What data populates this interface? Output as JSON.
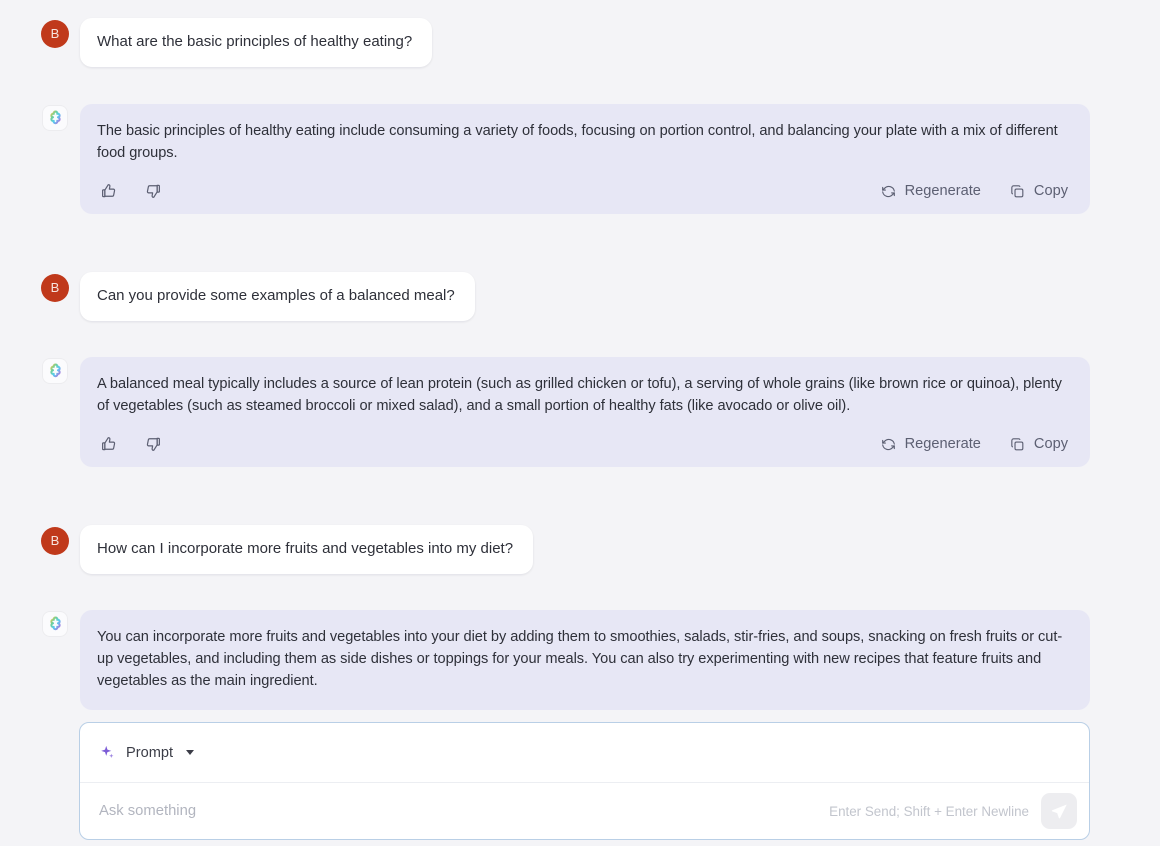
{
  "theme": {
    "page_background": "#f4f4f7",
    "user_bubble": "#ffffff",
    "assistant_bubble": "#e7e7f5",
    "user_avatar_color": "#c0391b",
    "composer_border": "#b9cfe6",
    "prompt_accent": "#7c5cd6",
    "text_color": "#2e3039",
    "muted_text": "#5c5f72"
  },
  "conversation": [
    {
      "role": "user",
      "avatar_initial": "B",
      "text": "What are the basic principles of healthy eating?"
    },
    {
      "role": "assistant",
      "avatar_icon": "sparkle-flower-icon",
      "text": "The basic principles of healthy eating include consuming a variety of foods, focusing on portion control, and balancing your plate with a mix of different food groups.",
      "actions": {
        "thumbs_up_icon": "thumbs-up-icon",
        "thumbs_down_icon": "thumbs-down-icon",
        "regenerate_label": "Regenerate",
        "copy_label": "Copy"
      }
    },
    {
      "role": "user",
      "avatar_initial": "B",
      "text": "Can you provide some examples of a balanced meal?"
    },
    {
      "role": "assistant",
      "avatar_icon": "sparkle-flower-icon",
      "text": "A balanced meal typically includes a source of lean protein (such as grilled chicken or tofu), a serving of whole grains (like brown rice or quinoa), plenty of vegetables (such as steamed broccoli or mixed salad), and a small portion of healthy fats (like avocado or olive oil).",
      "actions": {
        "thumbs_up_icon": "thumbs-up-icon",
        "thumbs_down_icon": "thumbs-down-icon",
        "regenerate_label": "Regenerate",
        "copy_label": "Copy"
      }
    },
    {
      "role": "user",
      "avatar_initial": "B",
      "text": "How can I incorporate more fruits and vegetables into my diet?"
    },
    {
      "role": "assistant",
      "avatar_icon": "sparkle-flower-icon",
      "text": "You can incorporate more fruits and vegetables into your diet by adding them to smoothies, salads, stir-fries, and soups, snacking on fresh fruits or cut-up vegetables, and including them as side dishes or toppings for your meals. You can also try experimenting with new recipes that feature fruits and vegetables as the main ingredient.",
      "actions": null
    }
  ],
  "composer": {
    "prompt_button_label": "Prompt",
    "prompt_icon": "sparkle-icon",
    "dropdown_icon": "chevron-down-icon",
    "input_value": "",
    "input_placeholder": "Ask something",
    "keyboard_hint": "Enter Send; Shift + Enter Newline",
    "send_icon": "send-plane-icon",
    "send_enabled": false
  }
}
